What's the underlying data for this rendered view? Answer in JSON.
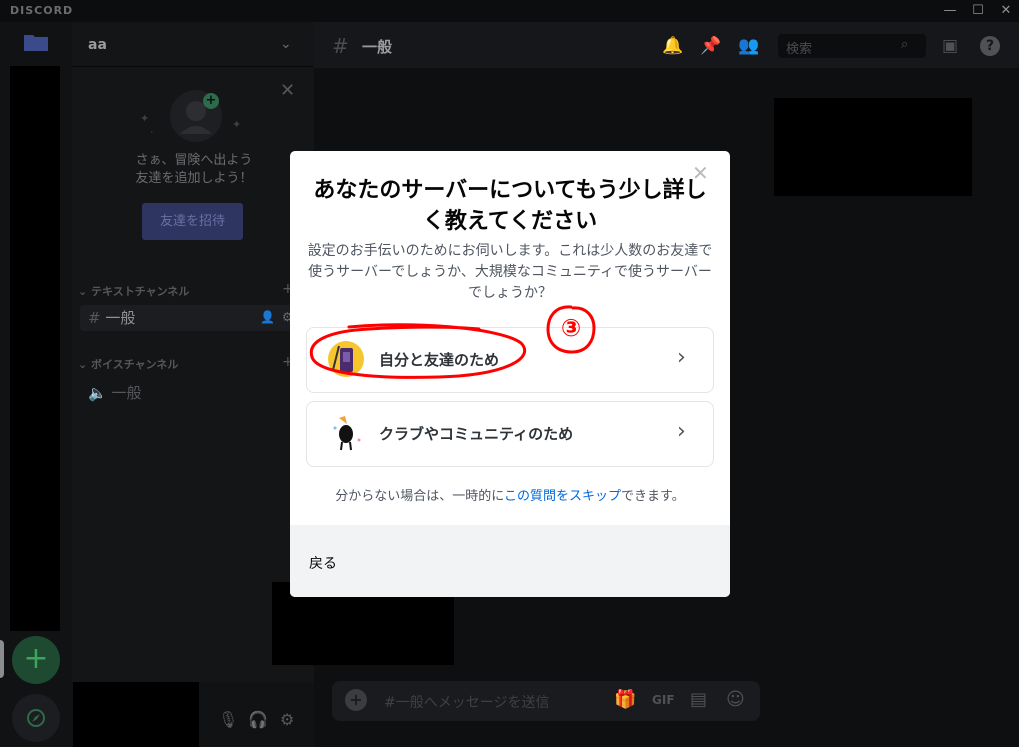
{
  "titlebar": {
    "logo": "DISCORD",
    "minimize": "—",
    "maximize": "☐",
    "close": "✕"
  },
  "server": {
    "name": "aa"
  },
  "promo": {
    "line1": "さぁ、冒険へ出よう",
    "line2": "友達を追加しよう！",
    "invite_button": "友達を招待"
  },
  "categories": {
    "text": "テキストチャンネル",
    "voice": "ボイスチャンネル"
  },
  "channels": {
    "text": "一般",
    "voice": "一般"
  },
  "chat": {
    "title": "一般",
    "search_placeholder": "検索",
    "message_placeholder": "#一般へメッセージを送信"
  },
  "modal": {
    "title": "あなたのサーバーについてもう少し詳しく教えてください",
    "subtitle": "設定のお手伝いのためにお伺いします。これは少人数のお友達で使うサーバーでしょうか、大規模なコミュニティで使うサーバーでしょうか？",
    "options": [
      {
        "label": "自分と友達のため",
        "icon": "friends-illustration-icon"
      },
      {
        "label": "クラブやコミュニティのため",
        "icon": "community-illustration-icon"
      }
    ],
    "skip_prefix": "分からない場合は、一時的に",
    "skip_link": "この質問をスキップ",
    "skip_suffix": "できます。",
    "back": "戻る"
  },
  "annotation": {
    "number": "③",
    "color": "#ff0000"
  },
  "colors": {
    "accent": "#0068e0",
    "green": "#3ba55d",
    "background": "#0e0f10"
  }
}
